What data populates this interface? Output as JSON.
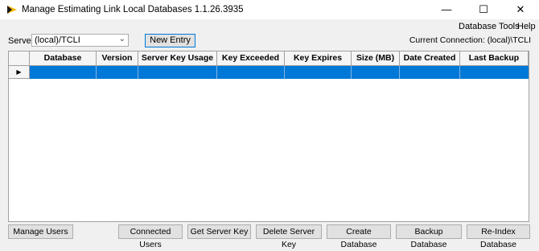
{
  "window": {
    "title": "Manage Estimating Link Local Databases 1.1.26.3935",
    "minimize_glyph": "—",
    "maximize_glyph": "☐",
    "close_glyph": "✕",
    "icon": "app-logo-icon"
  },
  "menu": {
    "database_tools": "Database Tools",
    "help": "Help"
  },
  "server": {
    "label": "Server",
    "selected": "(local)/TCLI",
    "new_entry": "New Entry",
    "current_connection": "Current Connection: (local)\\TCLI"
  },
  "grid": {
    "columns": [
      "Database",
      "Version",
      "Server Key Usage",
      "Key Exceeded",
      "Key Expires",
      "Size (MB)",
      "Date Created",
      "Last Backup"
    ],
    "current_row_indicator": "▶",
    "selection_color": "#0078d7"
  },
  "buttons": {
    "manage_users": "Manage Users",
    "connected_users": "Connected Users",
    "get_server_key": "Get Server Key",
    "delete_server_key": "Delete Server Key",
    "create_database": "Create Database",
    "backup_database": "Backup Database",
    "reindex_database": "Re-Index Database"
  }
}
